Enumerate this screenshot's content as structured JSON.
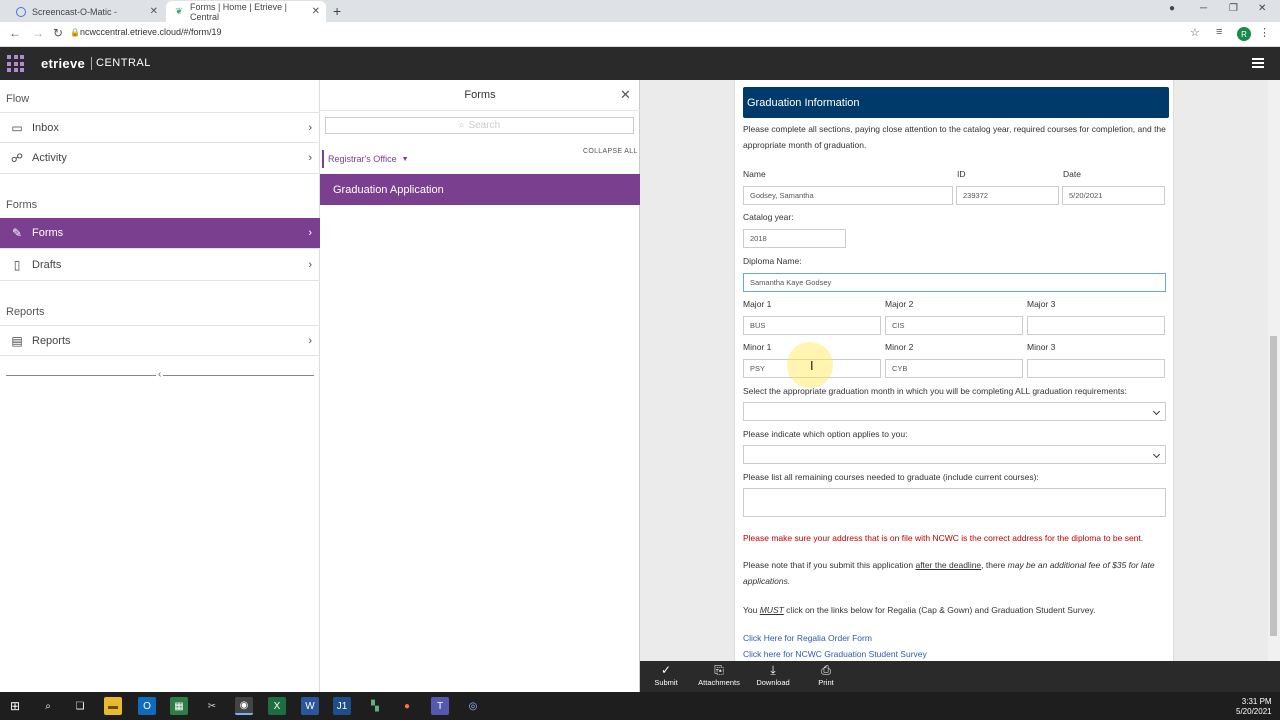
{
  "browser": {
    "tabs": [
      {
        "title": "Screencast-O-Matic -",
        "active": false
      },
      {
        "title": "Forms | Home | Etrieve | Central",
        "active": true
      }
    ],
    "url": "ncwccentral.etrieve.cloud/#/form/19",
    "profile_initial": "R"
  },
  "app": {
    "logo": "etrieve",
    "product": "CENTRAL"
  },
  "sidebar": {
    "sections": [
      {
        "label": "Flow",
        "items": [
          {
            "label": "Inbox",
            "icon": "inbox-icon"
          },
          {
            "label": "Activity",
            "icon": "activity-icon"
          }
        ]
      },
      {
        "label": "Forms",
        "items": [
          {
            "label": "Forms",
            "icon": "pencil-icon",
            "selected": true
          },
          {
            "label": "Drafts",
            "icon": "document-icon"
          }
        ]
      },
      {
        "label": "Reports",
        "items": [
          {
            "label": "Reports",
            "icon": "report-icon"
          }
        ]
      }
    ]
  },
  "forms_panel": {
    "title": "Forms",
    "search_placeholder": "Search",
    "collapse_all": "COLLAPSE ALL",
    "group": "Registrar's Office",
    "form_item": "Graduation Application"
  },
  "form": {
    "header": "Graduation Information",
    "intro": "Please complete all sections, paying close attention to the catalog year, required courses for completion, and the appropriate month of graduation.",
    "name_label": "Name",
    "name_value": "Godsey, Samantha",
    "id_label": "ID",
    "id_value": "239372",
    "date_label": "Date",
    "date_value": "5/20/2021",
    "catalog_label": "Catalog year:",
    "catalog_value": "2018",
    "diploma_label": "Diploma Name:",
    "diploma_value": "Samantha Kaye Godsey",
    "major1_label": "Major 1",
    "major1_value": "BUS",
    "major2_label": "Major 2",
    "major2_value": "CIS",
    "major3_label": "Major 3",
    "major3_value": "",
    "minor1_label": "Minor 1",
    "minor1_value": "PSY",
    "minor2_label": "Minor 2",
    "minor2_value": "CYB",
    "minor3_label": "Minor 3",
    "minor3_value": "",
    "month_label": "Select the appropriate graduation month in which you will be completing ALL graduation requirements:",
    "option_label": "Please indicate which option applies to you:",
    "courses_label": "Please list all remaining courses needed to graduate (include current courses):",
    "address_notice": "Please make sure your address that is on file with NCWC is the correct address for the diploma to be sent.",
    "fee_pre": "Please note that if you submit this application ",
    "fee_link": "after the deadline",
    "fee_mid": ", there ",
    "fee_italic": "may be an additional fee of $35 for late applications.",
    "must_pre": "You ",
    "must_word": "MUST",
    "must_post": " click on the links below for Regalia (Cap & Gown) and Graduation Student Survey.",
    "link_regalia": "Click Here for Regalia Order Form",
    "link_survey": "Click here for NCWC Graduation Student Survey"
  },
  "toolbar": {
    "submit": "Submit",
    "attachments": "Attachments",
    "download": "Download",
    "print": "Print"
  },
  "taskbar": {
    "time": "3:31 PM",
    "date": "5/20/2021"
  }
}
